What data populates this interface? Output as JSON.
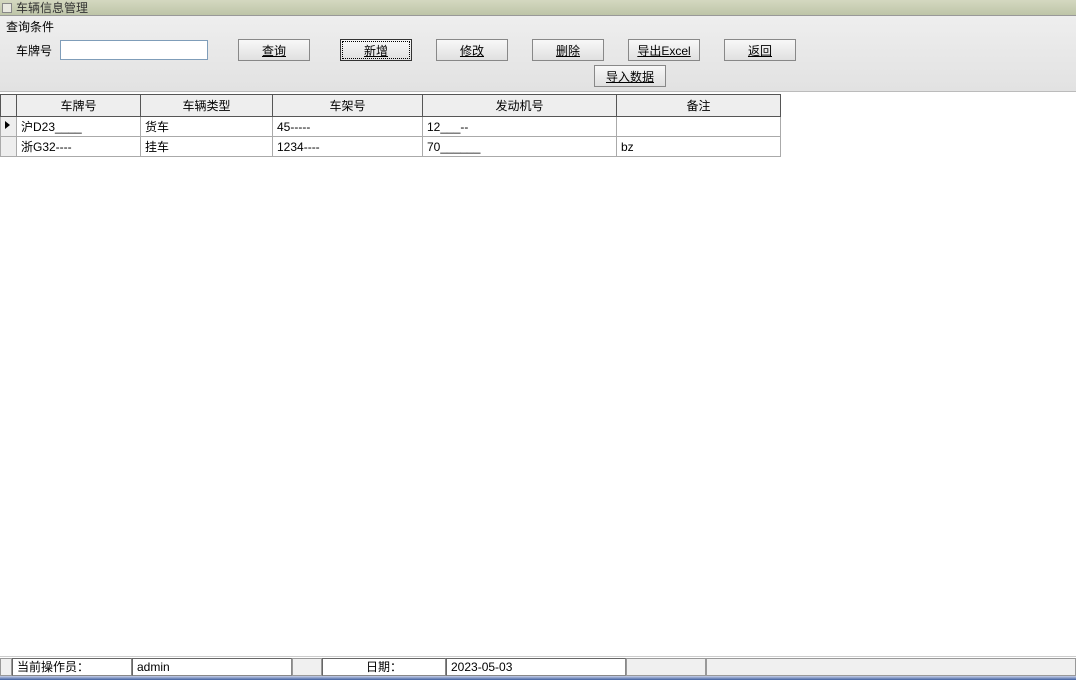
{
  "window": {
    "title": "车辆信息管理"
  },
  "query": {
    "panel_label": "查询条件",
    "plate_label": "车牌号",
    "plate_value": ""
  },
  "buttons": {
    "search": "查询",
    "add": "新增",
    "edit": "修改",
    "delete": "删除",
    "export": "导出Excel",
    "back": "返回",
    "import": "导入数据"
  },
  "grid": {
    "headers": {
      "plate": "车牌号",
      "type": "车辆类型",
      "vin": "车架号",
      "engine": "发动机号",
      "remark": "备注"
    },
    "rows": [
      {
        "selected": true,
        "plate": "沪D23____",
        "type": "货车",
        "vin": "45-----",
        "engine": "12___--",
        "remark": ""
      },
      {
        "selected": false,
        "plate": "浙G32----",
        "type": "挂车",
        "vin": "1234----",
        "engine": "70______",
        "remark": "bz"
      }
    ]
  },
  "status": {
    "operator_label": "当前操作员：",
    "operator_value": "admin",
    "date_label": "日期：",
    "date_value": "2023-05-03"
  }
}
